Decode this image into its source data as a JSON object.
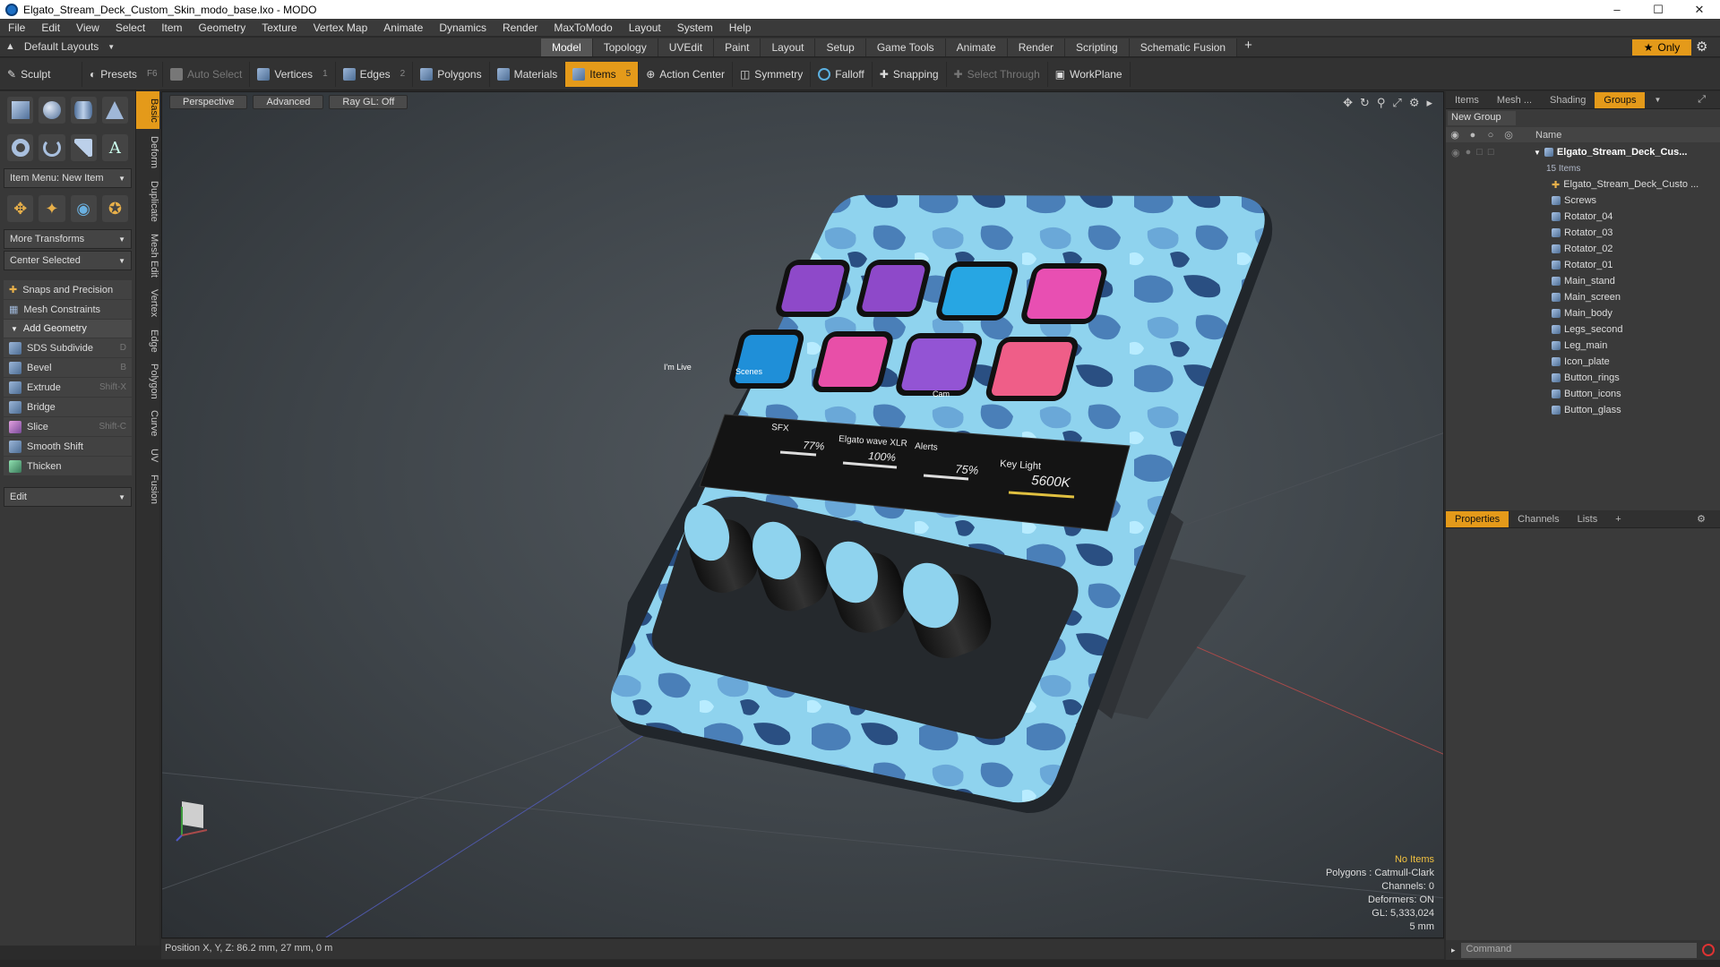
{
  "window": {
    "title": "Elgato_Stream_Deck_Custom_Skin_modo_base.lxo - MODO"
  },
  "menu": [
    "File",
    "Edit",
    "View",
    "Select",
    "Item",
    "Geometry",
    "Texture",
    "Vertex Map",
    "Animate",
    "Dynamics",
    "Render",
    "MaxToModo",
    "Layout",
    "System",
    "Help"
  ],
  "layout": {
    "default_layouts": "Default Layouts",
    "tabs": [
      "Model",
      "Topology",
      "UVEdit",
      "Paint",
      "Layout",
      "Setup",
      "Game Tools",
      "Animate",
      "Render",
      "Scripting",
      "Schematic Fusion"
    ],
    "active_tab": "Model",
    "only_label": "Only"
  },
  "toolbar": {
    "sculpt": "Sculpt",
    "presets": "Presets",
    "presets_key": "F6",
    "auto_select": "Auto Select",
    "vertices": "Vertices",
    "vertices_num": "1",
    "edges": "Edges",
    "edges_num": "2",
    "polygons": "Polygons",
    "materials": "Materials",
    "items": "Items",
    "items_num": "5",
    "action_center": "Action Center",
    "symmetry": "Symmetry",
    "falloff": "Falloff",
    "snapping": "Snapping",
    "select_through": "Select Through",
    "workplane": "WorkPlane"
  },
  "left": {
    "item_menu": "Item Menu: New Item",
    "more_transforms": "More Transforms",
    "center_selected": "Center Selected",
    "snaps": "Snaps and Precision",
    "mesh_constraints": "Mesh Constraints",
    "add_geometry": "Add Geometry",
    "tools": [
      {
        "label": "SDS Subdivide",
        "key": "D"
      },
      {
        "label": "Bevel",
        "key": "B"
      },
      {
        "label": "Extrude",
        "key": "Shift-X"
      },
      {
        "label": "Bridge",
        "key": ""
      },
      {
        "label": "Slice",
        "key": "Shift-C"
      },
      {
        "label": "Smooth Shift",
        "key": ""
      },
      {
        "label": "Thicken",
        "key": ""
      }
    ],
    "edit": "Edit",
    "vtabs": [
      "Basic",
      "Deform",
      "Duplicate",
      "Mesh Edit",
      "Vertex",
      "Edge",
      "Polygon",
      "Curve",
      "UV",
      "Fusion"
    ]
  },
  "viewport": {
    "view": "Perspective",
    "shading": "Advanced",
    "raygl": "Ray GL: Off",
    "stats": {
      "items": "No Items",
      "polygons": "Polygons : Catmull-Clark",
      "channels": "Channels: 0",
      "deformers": "Deformers: ON",
      "gl": "GL: 5,333,024",
      "grid": "5 mm"
    },
    "screen": {
      "sfx": "SFX",
      "sfx_pct": "77%",
      "mic": "Elgato wave XLR",
      "mic_pct": "100%",
      "alerts": "Alerts",
      "alerts_pct": "75%",
      "key_light": "Key Light",
      "kelvin": "5600K"
    },
    "key_labels": {
      "live": "I'm Live",
      "scenes": "Scenes",
      "cam": "Cam"
    }
  },
  "status": {
    "position": "Position X, Y, Z:  86.2 mm, 27 mm, 0 m"
  },
  "right": {
    "tabs": [
      "Items",
      "Mesh ...",
      "Shading",
      "Groups"
    ],
    "active_tab": "Groups",
    "new_group": "New Group",
    "name_col": "Name",
    "root": "Elgato_Stream_Deck_Cus...",
    "root_count": "15 Items",
    "children": [
      "Elgato_Stream_Deck_Custo ...",
      "Screws",
      "Rotator_04",
      "Rotator_03",
      "Rotator_02",
      "Rotator_01",
      "Main_stand",
      "Main_screen",
      "Main_body",
      "Legs_second",
      "Leg_main",
      "Icon_plate",
      "Button_rings",
      "Button_icons",
      "Button_glass"
    ],
    "prop_tabs": [
      "Properties",
      "Channels",
      "Lists"
    ],
    "active_prop_tab": "Properties",
    "command_placeholder": "Command"
  }
}
